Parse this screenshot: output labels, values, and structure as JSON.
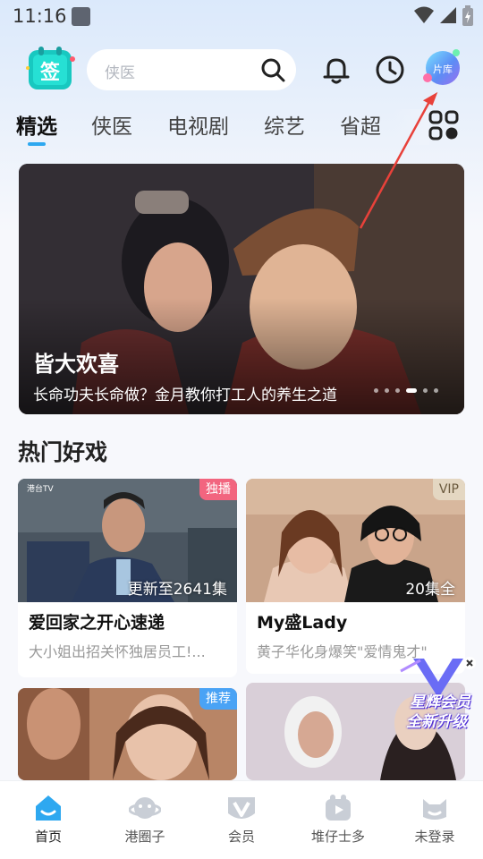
{
  "status_bar": {
    "time": "11:16"
  },
  "search": {
    "placeholder": "侠医"
  },
  "header": {
    "library_badge_label": "片库"
  },
  "tabs": [
    {
      "label": "精选"
    },
    {
      "label": "侠医"
    },
    {
      "label": "电视剧"
    },
    {
      "label": "综艺"
    },
    {
      "label": "省超"
    }
  ],
  "banner": {
    "title": "皆大欢喜",
    "subtitle": "长命功夫长命做？金月教你打工人的养生之道",
    "dot_count": 6,
    "active_dot": 3
  },
  "section": {
    "title": "热门好戏"
  },
  "cards": [
    {
      "tag": "独播",
      "tag_color": "#f2657f",
      "episodes": "更新至2641集",
      "title": "爱回家之开心速递",
      "desc": "大小姐出招关怀独居员工!..."
    },
    {
      "tag": "VIP",
      "tag_color": "rgba(230,220,200,0.85)",
      "episodes": "20集全",
      "title": "My盛Lady",
      "desc": "黄子华化身爆笑\"爱情鬼才\""
    },
    {
      "tag": "推荐",
      "tag_color": "#4aa3f5"
    }
  ],
  "vip_float": {
    "line1": "星辉会员",
    "line2": "全新升级"
  },
  "bottom_nav": [
    {
      "label": "首页"
    },
    {
      "label": "港圈子"
    },
    {
      "label": "会员"
    },
    {
      "label": "堆仔士多"
    },
    {
      "label": "未登录"
    }
  ],
  "colors": {
    "accent": "#2ea8f0",
    "exclusive_tag": "#f2657f",
    "recommend_tag": "#4aa3f5",
    "annotation_arrow": "#e8413a"
  }
}
